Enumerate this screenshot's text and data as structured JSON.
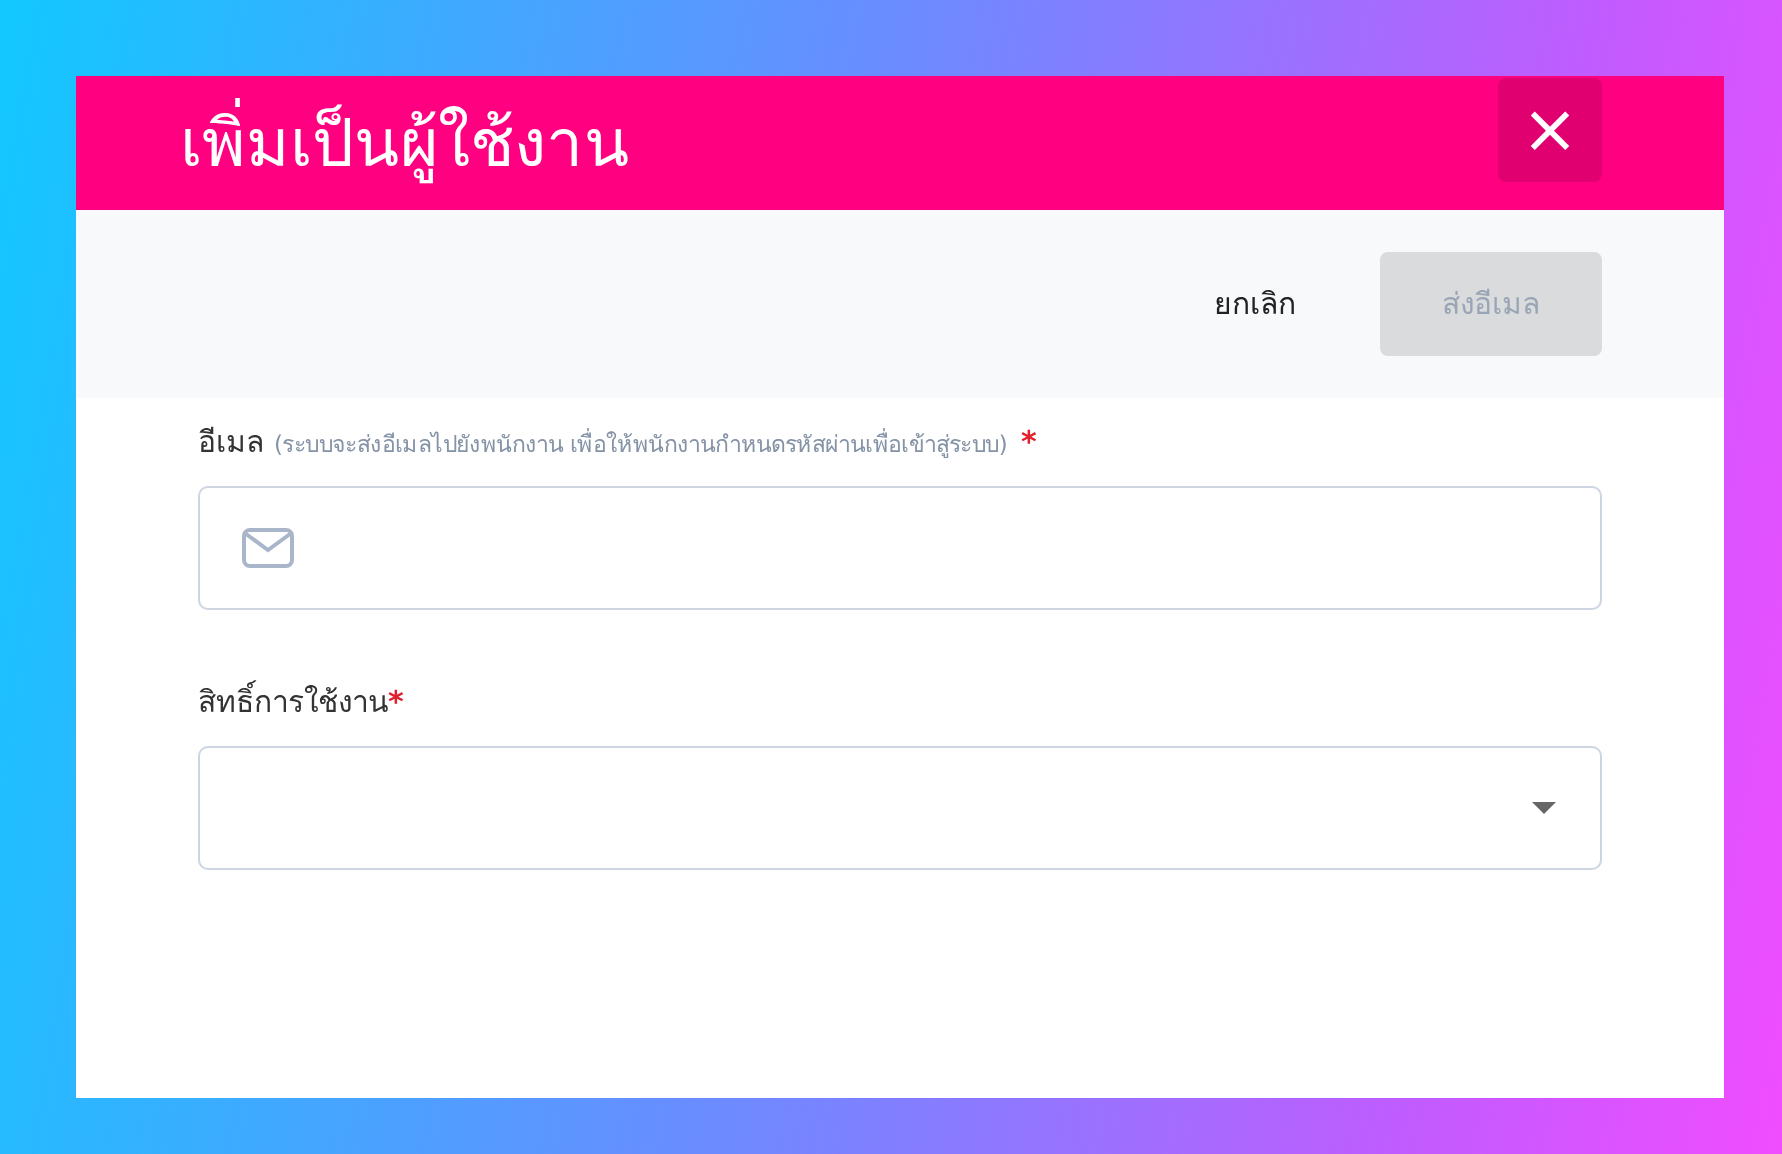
{
  "dialog": {
    "title": "เพิ่มเป็นผู้ใช้งาน",
    "close": "×"
  },
  "actions": [
    {
      "kind": "link",
      "label": "ยกเลิก",
      "disabled": false
    },
    {
      "kind": "primary",
      "label": "ส่งอีเมล",
      "disabled": true
    }
  ],
  "fields": [
    {
      "kind": "email",
      "label": "อีเมล",
      "hint": "(ระบบจะส่งอีเมลไปยังพนักงาน เพื่อให้พนักงานกำหนดรหัสผ่านเพื่อเข้าสู่ระบบ)",
      "required_mark": "*"
    },
    {
      "kind": "select",
      "label": "สิทธิ์การใช้งาน",
      "required_mark": "*"
    }
  ]
}
